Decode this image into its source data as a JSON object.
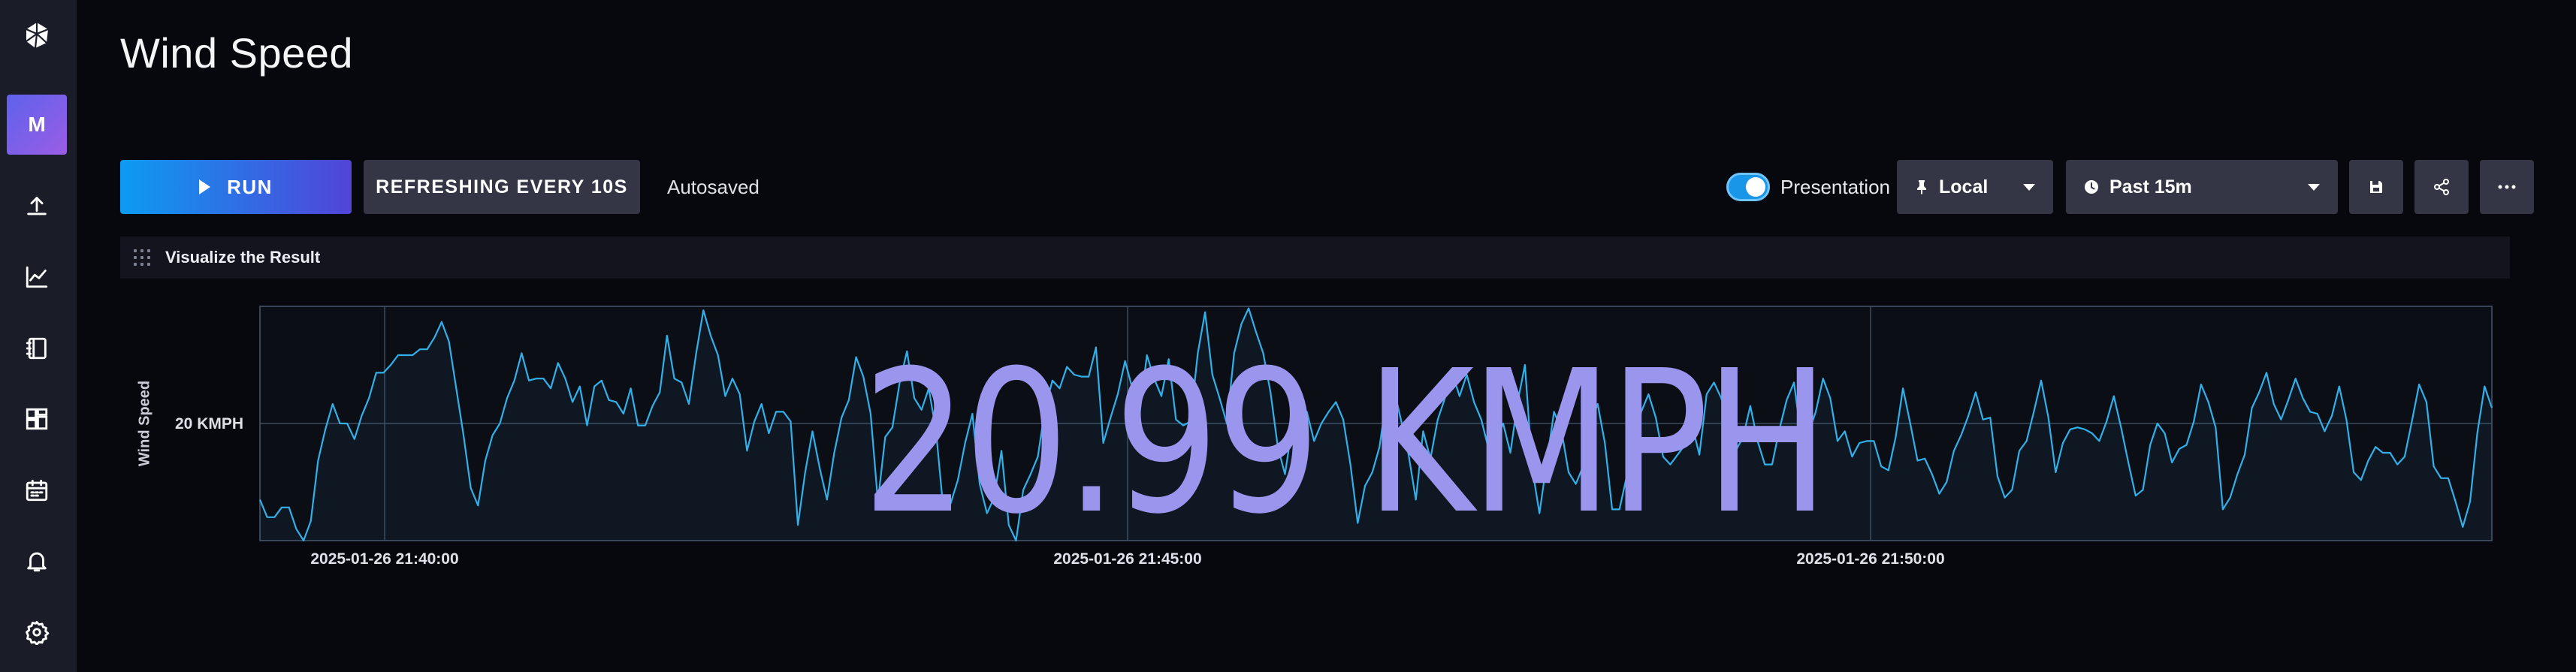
{
  "page": {
    "title": "Wind Speed"
  },
  "sidebar": {
    "avatar_letter": "M",
    "icons": [
      "logo-icon",
      "upload-icon",
      "graph-icon",
      "notebook-icon",
      "dashboards-icon",
      "calendar-icon",
      "bell-icon",
      "gear-icon"
    ]
  },
  "toolbar": {
    "run_label": "RUN",
    "refresh_label": "REFRESHING EVERY 10S",
    "autosaved_label": "Autosaved",
    "presentation_label": "Presentation",
    "presentation_on": true,
    "timezone_label": "Local",
    "timerange_label": "Past 15m"
  },
  "cell": {
    "title": "Visualize the Result"
  },
  "chart_data": {
    "type": "line",
    "ylabel": "Wind Speed",
    "ytick_labels": [
      "20 KMPH"
    ],
    "xtick_labels": [
      "2025-01-26 21:40:00",
      "2025-01-26 21:45:00",
      "2025-01-26 21:50:00"
    ],
    "big_value": "20.99 KMPH",
    "series": [
      {
        "color": "#31b0ea",
        "values": [
          16.1,
          15.2,
          15.2,
          15.7,
          15.7,
          14.6,
          14.0,
          15.0,
          18.1,
          19.7,
          21.0,
          20.0,
          20.0,
          19.2,
          20.4,
          21.3,
          22.6,
          22.6,
          23.0,
          23.5,
          23.5,
          23.5,
          23.8,
          23.8,
          24.4,
          25.2,
          24.2,
          21.8,
          19.4,
          16.7,
          15.8,
          18.1,
          19.4,
          20.0,
          21.3,
          22.2,
          23.6,
          22.2,
          22.3,
          22.3,
          21.8,
          23.1,
          22.3,
          21.1,
          21.9,
          19.9,
          21.9,
          22.2,
          21.2,
          21.1,
          20.5,
          21.8,
          19.9,
          19.9,
          20.9,
          21.6,
          24.5,
          22.3,
          22.1,
          21.0,
          23.6,
          25.8,
          24.5,
          23.5,
          21.4,
          22.3,
          21.5,
          18.6,
          20.1,
          21.0,
          19.5,
          20.6,
          20.6,
          20.1,
          14.8,
          17.5,
          19.6,
          17.7,
          16.1,
          18.5,
          20.3,
          21.2,
          23.4,
          22.4,
          20.5,
          16.0,
          19.3,
          19.8,
          22.1,
          23.7,
          21.3,
          20.7,
          21.8,
          19.6,
          15.6,
          15.9,
          17.1,
          19.0,
          20.5,
          16.9,
          15.4,
          16.2,
          18.6,
          14.8,
          14.0,
          16.6,
          17.4,
          18.3,
          20.8,
          22.2,
          21.8,
          22.9,
          22.5,
          22.4,
          22.4,
          23.9,
          19.0,
          20.3,
          21.5,
          23.2,
          21.8,
          20.5,
          23.5,
          22.3,
          21.4,
          23.3,
          20.2,
          19.9,
          20.1,
          23.6,
          25.7,
          22.5,
          21.3,
          20.0,
          23.6,
          25.1,
          25.9,
          24.7,
          23.6,
          21.6,
          18.8,
          17.4,
          19.9,
          20.3,
          20.6,
          19.1,
          20.0,
          20.6,
          21.1,
          20.2,
          17.9,
          14.9,
          16.8,
          17.5,
          18.8,
          21.4,
          21.7,
          20.1,
          18.4,
          16.1,
          19.6,
          18.2,
          20.2,
          21.3,
          22.6,
          21.4,
          22.5,
          21.1,
          20.2,
          18.7,
          19.1,
          20.0,
          18.5,
          21.1,
          23.0,
          17.7,
          15.4,
          18.0,
          20.6,
          19.7,
          17.5,
          16.9,
          17.8,
          20.0,
          21.0,
          19.0,
          15.6,
          15.6,
          17.3,
          18.6,
          20.6,
          21.5,
          20.3,
          18.3,
          17.9,
          18.4,
          18.9,
          19.9,
          18.4,
          21.5,
          22.1,
          21.3,
          20.1,
          18.6,
          19.3,
          20.9,
          19.1,
          17.9,
          17.9,
          19.7,
          21.2,
          22.1,
          19.3,
          19.5,
          20.6,
          22.3,
          21.3,
          19.1,
          19.6,
          18.3,
          19.0,
          19.1,
          19.1,
          17.8,
          17.6,
          19.3,
          21.8,
          20.0,
          18.1,
          18.2,
          17.4,
          16.4,
          17.0,
          18.6,
          19.4,
          20.4,
          21.6,
          20.2,
          20.3,
          17.3,
          16.2,
          16.6,
          18.6,
          19.1,
          20.6,
          22.2,
          20.3,
          17.5,
          19.0,
          19.7,
          19.8,
          19.7,
          19.5,
          19.1,
          20.1,
          21.4,
          19.8,
          18.0,
          16.3,
          16.6,
          18.9,
          20.0,
          19.5,
          18.0,
          18.7,
          18.9,
          20.1,
          22.0,
          21.1,
          19.8,
          15.6,
          16.2,
          17.4,
          18.4,
          20.8,
          21.6,
          22.6,
          21.0,
          20.2,
          21.2,
          22.3,
          21.3,
          20.6,
          20.5,
          19.6,
          20.4,
          21.9,
          20.2,
          17.5,
          17.1,
          18.1,
          18.8,
          18.5,
          18.5,
          17.9,
          18.3,
          20.1,
          22.0,
          21.1,
          17.8,
          17.2,
          17.2,
          16.0,
          14.7,
          16.0,
          19.5,
          21.9,
          20.8
        ],
        "y_ref": 20.0,
        "ylim": [
          14.0,
          26.0
        ]
      }
    ]
  }
}
